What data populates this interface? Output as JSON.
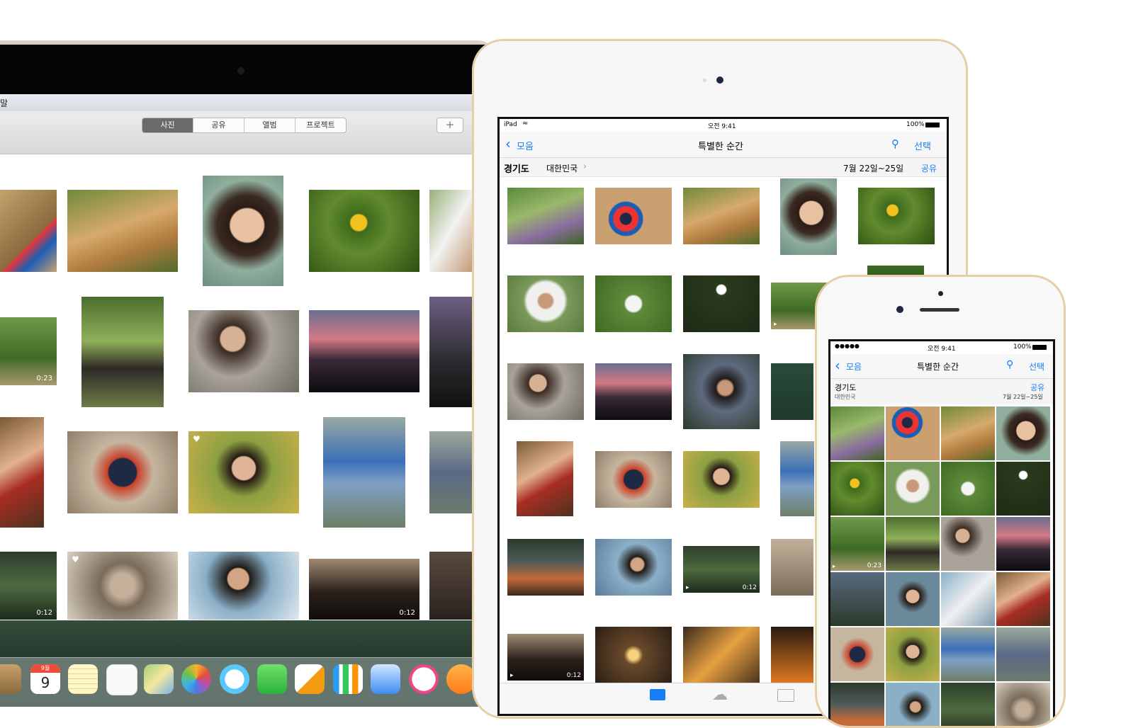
{
  "mac": {
    "menu_text": "말",
    "tabs": [
      "사진",
      "공유",
      "앨범",
      "프로젝트"
    ],
    "active_tab": "사진",
    "add_button": "+",
    "video_durations": [
      "0:23",
      "0:12",
      "0:12"
    ],
    "dock_calendar": {
      "month": "9월",
      "day": "9"
    }
  },
  "ipad": {
    "status": {
      "device": "iPad",
      "time": "오전 9:41",
      "battery": "100%"
    },
    "nav": {
      "back": "모음",
      "title": "특별한 순간",
      "select": "선택"
    },
    "section": {
      "region": "경기도",
      "country": "대한민국",
      "dates": "7월 22일~25일",
      "share": "공유"
    },
    "video_durations": [
      "0:12",
      "0:12"
    ]
  },
  "iphone": {
    "status": {
      "time": "오전 9:41",
      "battery": "100%"
    },
    "nav": {
      "back": "모음",
      "title": "특별한 순간",
      "select": "선택"
    },
    "section": {
      "region": "경기도",
      "country": "대한민국",
      "dates": "7월 22일~25일",
      "share": "공유"
    },
    "video_duration": "0:23"
  },
  "colors": {
    "accent": "#147efb",
    "gold_frame": "#e6cfa6",
    "mac_tab_active": "#6a6a6a"
  },
  "icons": [
    "back-chevron-icon",
    "search-icon",
    "wifi-icon",
    "battery-icon",
    "heart-icon",
    "video-camera-icon",
    "photos-tab-icon",
    "icloud-tab-icon",
    "albums-tab-icon"
  ]
}
